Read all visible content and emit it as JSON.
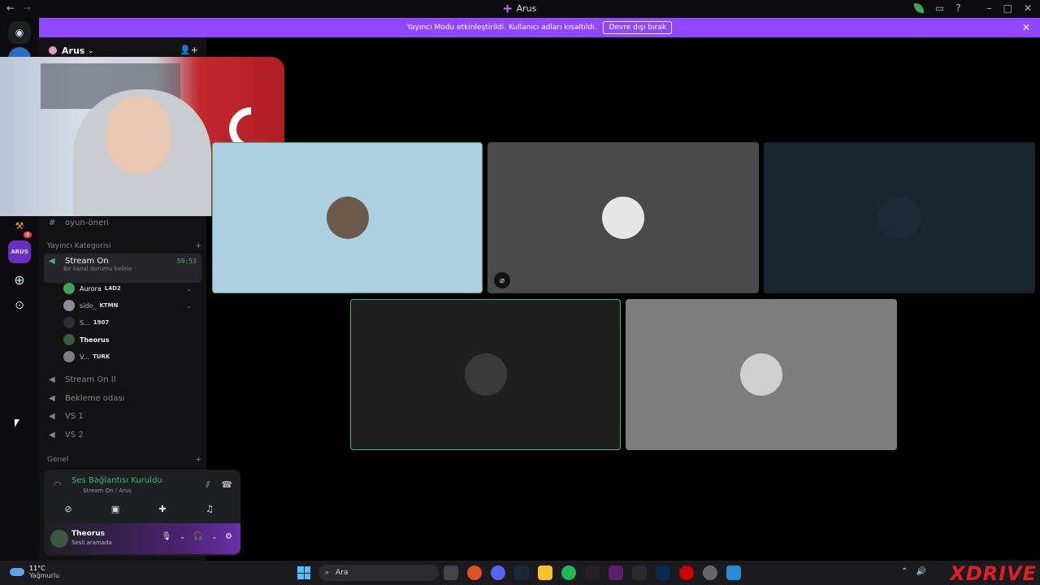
{
  "app": {
    "title": "Arus"
  },
  "banner": {
    "message": "Yayıncı Modu etkinleştirildi. Kullanıcı adları kısaltıldı.",
    "button": "Devre dışı bırak"
  },
  "server": {
    "name": "Arus",
    "rail_badge": "4"
  },
  "channels": {
    "text_channel": "oyun-öneri",
    "category_1": "Yayıncı Kategorisi",
    "active_voice": {
      "name": "Stream On",
      "status": "Bir kanal durumu belirle",
      "timer": "59:53"
    },
    "members": [
      {
        "name": "Aurora",
        "tag": "L4D2",
        "color": "#3ba55c"
      },
      {
        "name": "sido_",
        "tag": "KTMN",
        "color": "#8a8e99"
      },
      {
        "name": "S...",
        "tag": "1907",
        "color": "#2a2d33"
      },
      {
        "name": "Theorus",
        "tag": "",
        "color": "#3a5a40"
      },
      {
        "name": "V...",
        "tag": "TURK",
        "color": "#7a7d85"
      }
    ],
    "voice_channels": [
      {
        "name": "Stream On II"
      },
      {
        "name": "Bekleme odası"
      },
      {
        "name": "VS 1"
      },
      {
        "name": "VS 2"
      }
    ],
    "category_2": "Genel"
  },
  "voice_panel": {
    "status": "Ses Bağlantısı Kuruldu",
    "location": "Stream On / Arus"
  },
  "user": {
    "name": "Theorus",
    "status": "Sesli aramada"
  },
  "tiles": [
    {
      "name": "aurora-tile",
      "bg": "#acd0e2",
      "border": "#43b581",
      "avatar": "#6b5a4a",
      "muted": false
    },
    {
      "name": "sido-tile",
      "bg": "#4a4a4a",
      "border": "none",
      "avatar": "#e6e6e6",
      "muted": true
    },
    {
      "name": "s-tile",
      "bg": "#1b2530",
      "border": "none",
      "avatar": "#1e2a38",
      "muted": false
    },
    {
      "name": "theorus-tile",
      "bg": "#1f1f1f",
      "border": "#43b581",
      "avatar": "#3a3a3a",
      "muted": false
    },
    {
      "name": "v-tile",
      "bg": "#7d7d7d",
      "border": "none",
      "avatar": "#d0d0d0",
      "muted": false
    }
  ],
  "taskbar": {
    "temperature": "11°C",
    "weather": "Yağmurlu",
    "search_placeholder": "Ara",
    "brand": "XDRIVE"
  }
}
